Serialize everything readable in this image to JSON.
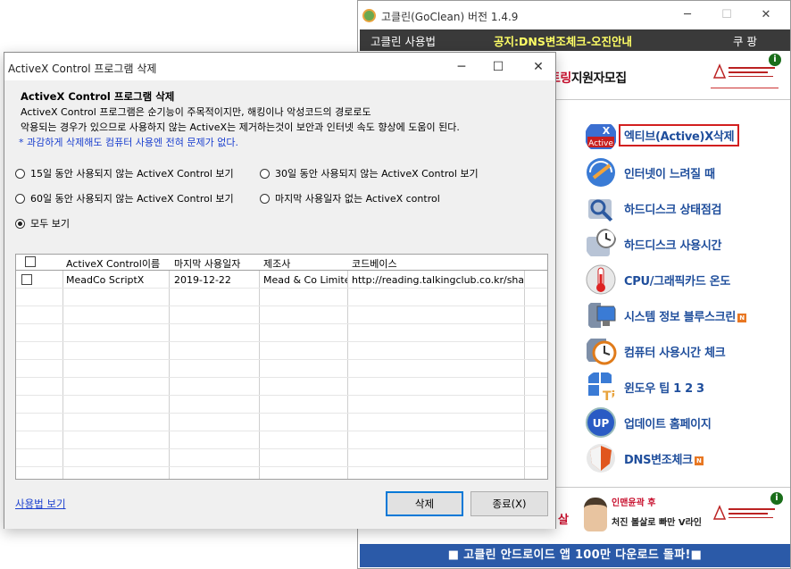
{
  "goclean": {
    "title": "고클린(GoClean) 버전 1.4.9",
    "menu": {
      "usage": "고클린 사용법",
      "notice": "공지:DNS변조체크-오진안내",
      "coupon": "쿠 팡"
    },
    "banner_top": {
      "recruit_prefix": "트링",
      "recruit_suffix": "지원자모집"
    },
    "info_icon": "i",
    "items": [
      {
        "label": "엑티브(Active)X삭제",
        "icon": "activex-icon",
        "new": false
      },
      {
        "label": "인터넷이 느려질 때",
        "icon": "internet-speed-icon",
        "new": false
      },
      {
        "label": "하드디스크 상태점검",
        "icon": "disk-check-icon",
        "new": false
      },
      {
        "label": "하드디스크 사용시간",
        "icon": "disk-time-icon",
        "new": false
      },
      {
        "label": "CPU/그래픽카드 온도",
        "icon": "temperature-icon",
        "new": false
      },
      {
        "label": "시스템 정보  블루스크린",
        "icon": "system-info-icon",
        "new": true
      },
      {
        "label": "컴퓨터 사용시간 체크",
        "icon": "clock-icon",
        "new": false
      },
      {
        "label": "윈도우 팁 1   2   3",
        "icon": "tip-icon",
        "new": false
      },
      {
        "label": "업데이트     홈페이지",
        "icon": "update-icon",
        "new": false
      },
      {
        "label": "DNS변조체크",
        "icon": "shield-icon",
        "new": true
      }
    ],
    "new_badge": "N",
    "banner_bottom": {
      "red_text": "살",
      "promo_line1": "인맨윤곽 후",
      "promo_line2": "처진 볼살로 빠만 V라인"
    },
    "status": "■ 고클린 안드로이드 앱 100만 다운로드 돌파!■",
    "colors": {
      "accent": "#1f4e9c",
      "status_bg": "#2b5aa8",
      "menubar_bg": "#3a3a3a",
      "highlight": "#d21f1f"
    }
  },
  "dialog": {
    "title": "ActiveX Control 프로그램 삭제",
    "heading": "ActiveX Control 프로그램 삭제",
    "desc_line1": "ActiveX Control 프로그램은 순기능이 주목적이지만, 해킹이나 악성코드의 경로로도",
    "desc_line2": "악용되는 경우가 있으므로 사용하지 않는 ActiveX는 제거하는것이 보안과 인터넷 속도 향상에 도움이 된다.",
    "note": "* 과감하게 삭제해도 컴퓨터 사용엔 전혀 문제가 없다.",
    "radios": [
      {
        "label": "15일 동안 사용되지 않는 ActiveX Control 보기",
        "checked": false
      },
      {
        "label": "30일 동안 사용되지 않는 ActiveX Control 보기",
        "checked": false
      },
      {
        "label": "60일 동안 사용되지 않는 ActiveX Control 보기",
        "checked": false
      },
      {
        "label": "마지막 사용일자 없는 ActiveX control",
        "checked": false
      },
      {
        "label": "모두 보기",
        "checked": true
      }
    ],
    "table": {
      "columns": [
        "ActiveX Control이름",
        "마지막 사용일자",
        "제조사",
        "코드베이스"
      ],
      "rows": [
        [
          "MeadCo ScriptX",
          "2019-12-22",
          "Mead & Co Limited",
          "http://reading.talkingclub.co.kr/shar..."
        ]
      ]
    },
    "usage_link": "사용법 보기",
    "delete_button": "삭제",
    "close_button": "종료(X)"
  }
}
